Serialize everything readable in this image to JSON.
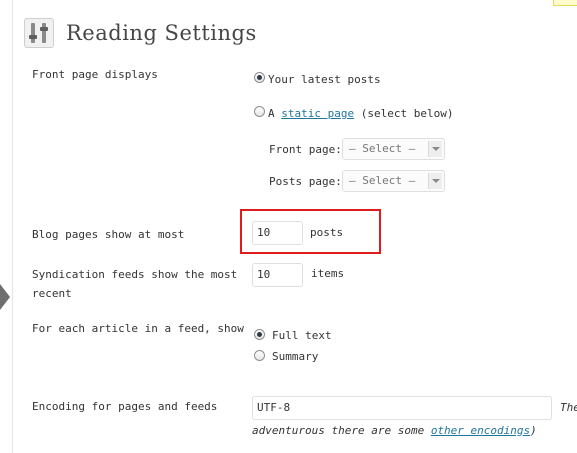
{
  "page": {
    "title": "Reading Settings"
  },
  "front_page": {
    "label": "Front page displays",
    "option_latest": "Your latest posts",
    "option_static_prefix": "A",
    "option_static_link": "static page",
    "option_static_suffix": "(select below)",
    "front_page_label": "Front page:",
    "front_page_value": "— Select —",
    "posts_page_label": "Posts page:",
    "posts_page_value": "— Select —"
  },
  "blog_pages": {
    "label": "Blog pages show at most",
    "value": "10",
    "unit": "posts"
  },
  "syndication": {
    "label_line1": "Syndication feeds show the most",
    "label_line2": "recent",
    "value": "10",
    "unit": "items"
  },
  "feed_article": {
    "label": "For each article in a feed, show",
    "option_full": "Full text",
    "option_summary": "Summary"
  },
  "encoding": {
    "label": "Encoding for pages and feeds",
    "value": "UTF-8",
    "hint_cut": "The",
    "hint_line2_prefix": "adventurous there are some",
    "hint_link": "other encodings",
    "hint_line2_suffix": ")"
  },
  "colors": {
    "link": "#21759b",
    "highlight": "#e01b1b"
  }
}
